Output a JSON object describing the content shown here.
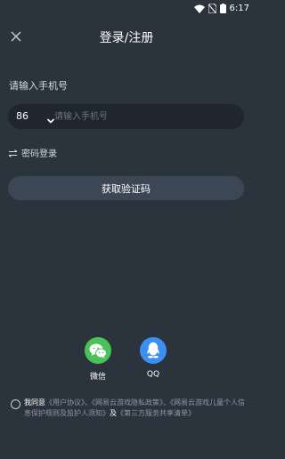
{
  "status": {
    "time": "6:17"
  },
  "header": {
    "title": "登录/注册"
  },
  "phone": {
    "label": "请输入手机号",
    "country_code": "86",
    "placeholder": "请输入手机号"
  },
  "password_login": {
    "label": "密码登录"
  },
  "verify_button": {
    "label": "获取验证码"
  },
  "social": {
    "wechat": {
      "label": "微信",
      "color": "#49c25a"
    },
    "qq": {
      "label": "QQ",
      "color": "#3a8ff0"
    }
  },
  "agreement": {
    "prefix": "我同意",
    "user_agreement": "《用户协议》",
    "sep1": "、",
    "privacy_policy": "《网易云游戏隐私政策》",
    "sep2": "、",
    "child_policy": "《网易云游戏儿童个人信息保护规则及监护人须知》",
    "and": "及",
    "third_party": "《第三方服务共享清单》"
  },
  "colors": {
    "background": "#2b333d",
    "input_bg": "#1f262e",
    "button_bg": "#3c4755"
  }
}
